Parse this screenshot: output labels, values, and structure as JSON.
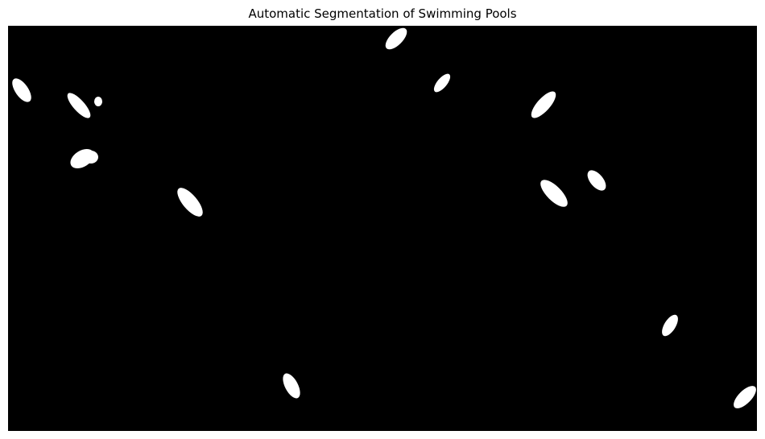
{
  "figure": {
    "title": "Automatic Segmentation of Swimming Pools"
  },
  "mask": {
    "background_color": "#000000",
    "pool_color": "#ffffff",
    "detected_pool_count": 14
  }
}
